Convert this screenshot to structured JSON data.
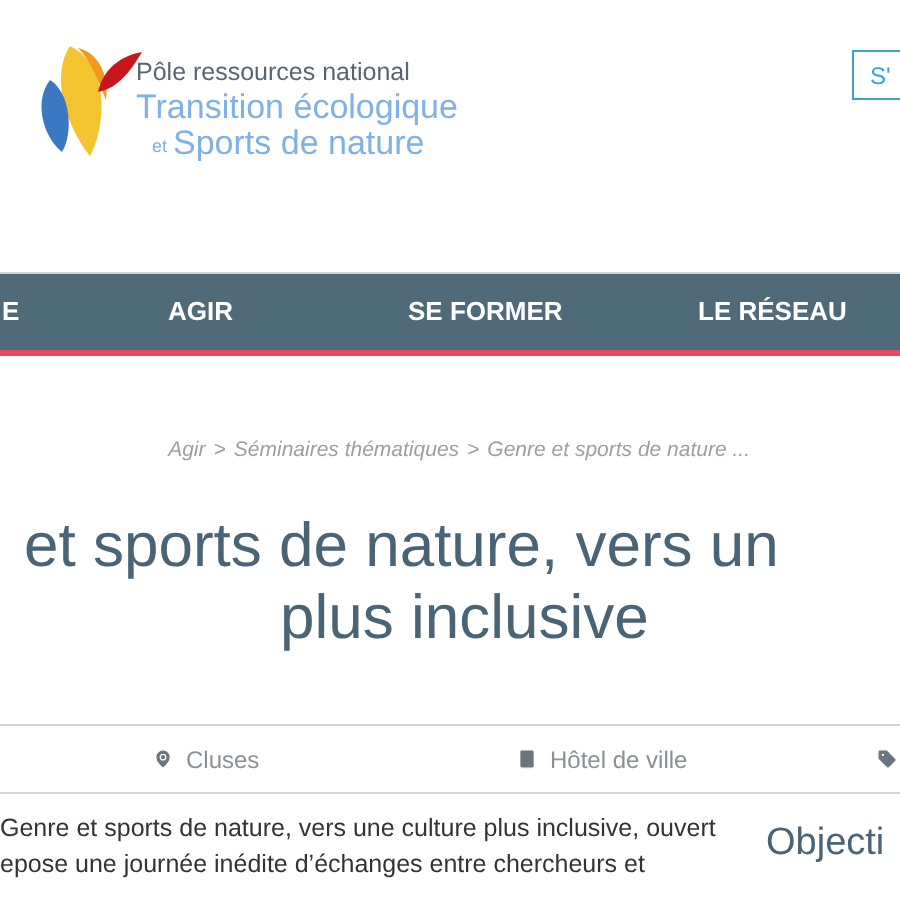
{
  "header": {
    "logo": {
      "line_1": "Pôle ressources national",
      "line_2": "Transition écologique",
      "line_3_prefix": "et",
      "line_3": "Sports de nature"
    },
    "button": "S'"
  },
  "nav": {
    "items": [
      {
        "label": "E"
      },
      {
        "label": "AGIR"
      },
      {
        "label": "SE FORMER"
      },
      {
        "label": "LE RÉSEAU"
      }
    ]
  },
  "breadcrumb": {
    "items": [
      "Agir",
      "Séminaires thématiques",
      "Genre et sports de nature ..."
    ],
    "separator": ">"
  },
  "title": [
    "et sports de nature, vers un",
    "plus inclusive"
  ],
  "info": [
    {
      "kind": "place",
      "text": "Cluses"
    },
    {
      "kind": "venue",
      "text": "Hôtel de ville"
    },
    {
      "kind": "tag"
    }
  ],
  "body": [
    "Genre et sports de nature, vers une culture plus inclusive, ouvert",
    "epose une journée inédite d’échanges entre chercheurs et"
  ],
  "aside": {
    "heading": "Objecti"
  }
}
